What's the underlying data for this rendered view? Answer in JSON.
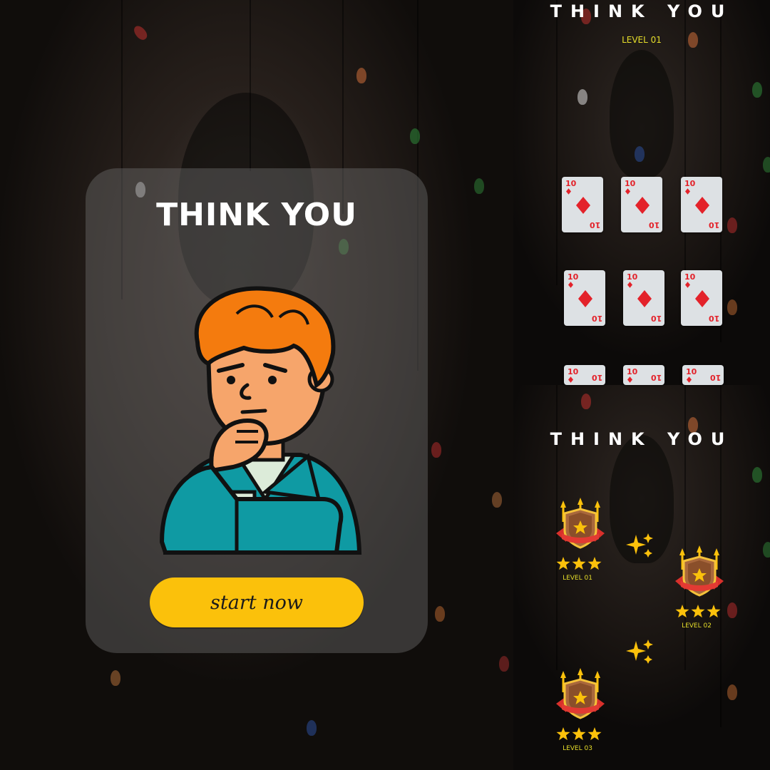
{
  "app": {
    "title": "THINK YOU"
  },
  "start_screen": {
    "title": "THINK YOU",
    "button_label": "start now"
  },
  "game_screen": {
    "title": "THINK YOU",
    "level_label": "LEVEL 01",
    "cards": [
      {
        "rank": "10",
        "suit": "diamond"
      },
      {
        "rank": "10",
        "suit": "diamond"
      },
      {
        "rank": "10",
        "suit": "diamond"
      },
      {
        "rank": "10",
        "suit": "diamond"
      },
      {
        "rank": "10",
        "suit": "diamond"
      },
      {
        "rank": "10",
        "suit": "diamond"
      },
      {
        "rank": "10",
        "suit": "diamond"
      },
      {
        "rank": "10",
        "suit": "diamond"
      },
      {
        "rank": "10",
        "suit": "diamond"
      }
    ]
  },
  "levels_screen": {
    "title": "THINK YOU",
    "levels": [
      {
        "label": "LEVEL 01",
        "stars": 3
      },
      {
        "label": "LEVEL 02",
        "stars": 3
      },
      {
        "label": "LEVEL 03",
        "stars": 3
      }
    ]
  },
  "colors": {
    "accent": "#fbc10b",
    "level_text": "#e6de2a",
    "card_suit": "#e3222a"
  },
  "icons": [
    "thinking-man-icon",
    "diamond-icon",
    "shield-badge-icon",
    "star-icon",
    "sparkle-icon"
  ]
}
